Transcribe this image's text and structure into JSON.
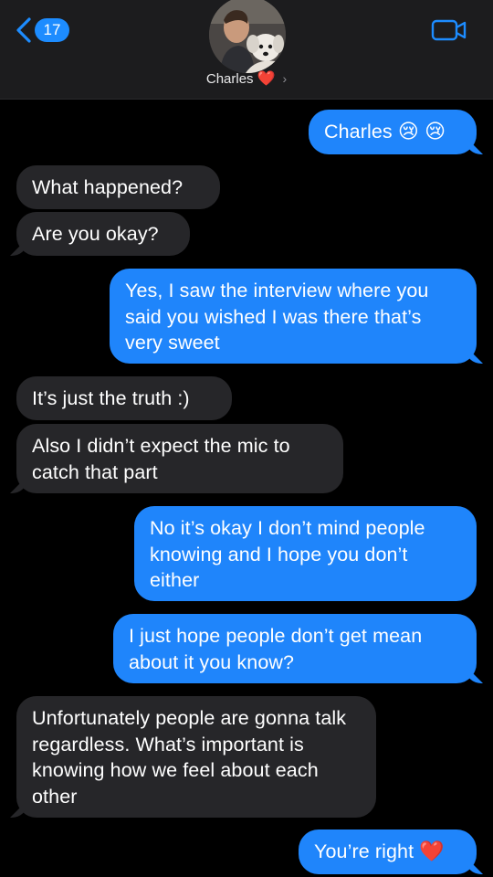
{
  "header": {
    "back_count": "17",
    "contact_name": "Charles",
    "contact_emoji": "❤️",
    "video_icon": "video-camera-icon",
    "accent": "#1d8cff"
  },
  "messages": [
    {
      "from": "me",
      "text": "Charles",
      "emoji": "😢 😢"
    },
    {
      "from": "them",
      "text": "What happened?"
    },
    {
      "from": "them",
      "text": "Are you okay?"
    },
    {
      "from": "me",
      "text": "Yes, I saw the interview where you said you wished I was there that’s very sweet"
    },
    {
      "from": "them",
      "text": "It’s just the truth :)"
    },
    {
      "from": "them",
      "text": "Also I didn’t expect the mic to catch that part"
    },
    {
      "from": "me",
      "text": "No it’s okay I don’t mind people knowing and I hope you don’t either"
    },
    {
      "from": "me",
      "text": "I just hope people don’t get mean about it you know?"
    },
    {
      "from": "them",
      "text": "Unfortunately people are gonna talk regardless. What’s important is knowing how we feel about each other"
    },
    {
      "from": "me",
      "text": "You’re right",
      "emoji": "❤️"
    }
  ],
  "colors": {
    "outgoing": "#1f85fb",
    "incoming": "#262629",
    "background": "#000000"
  }
}
